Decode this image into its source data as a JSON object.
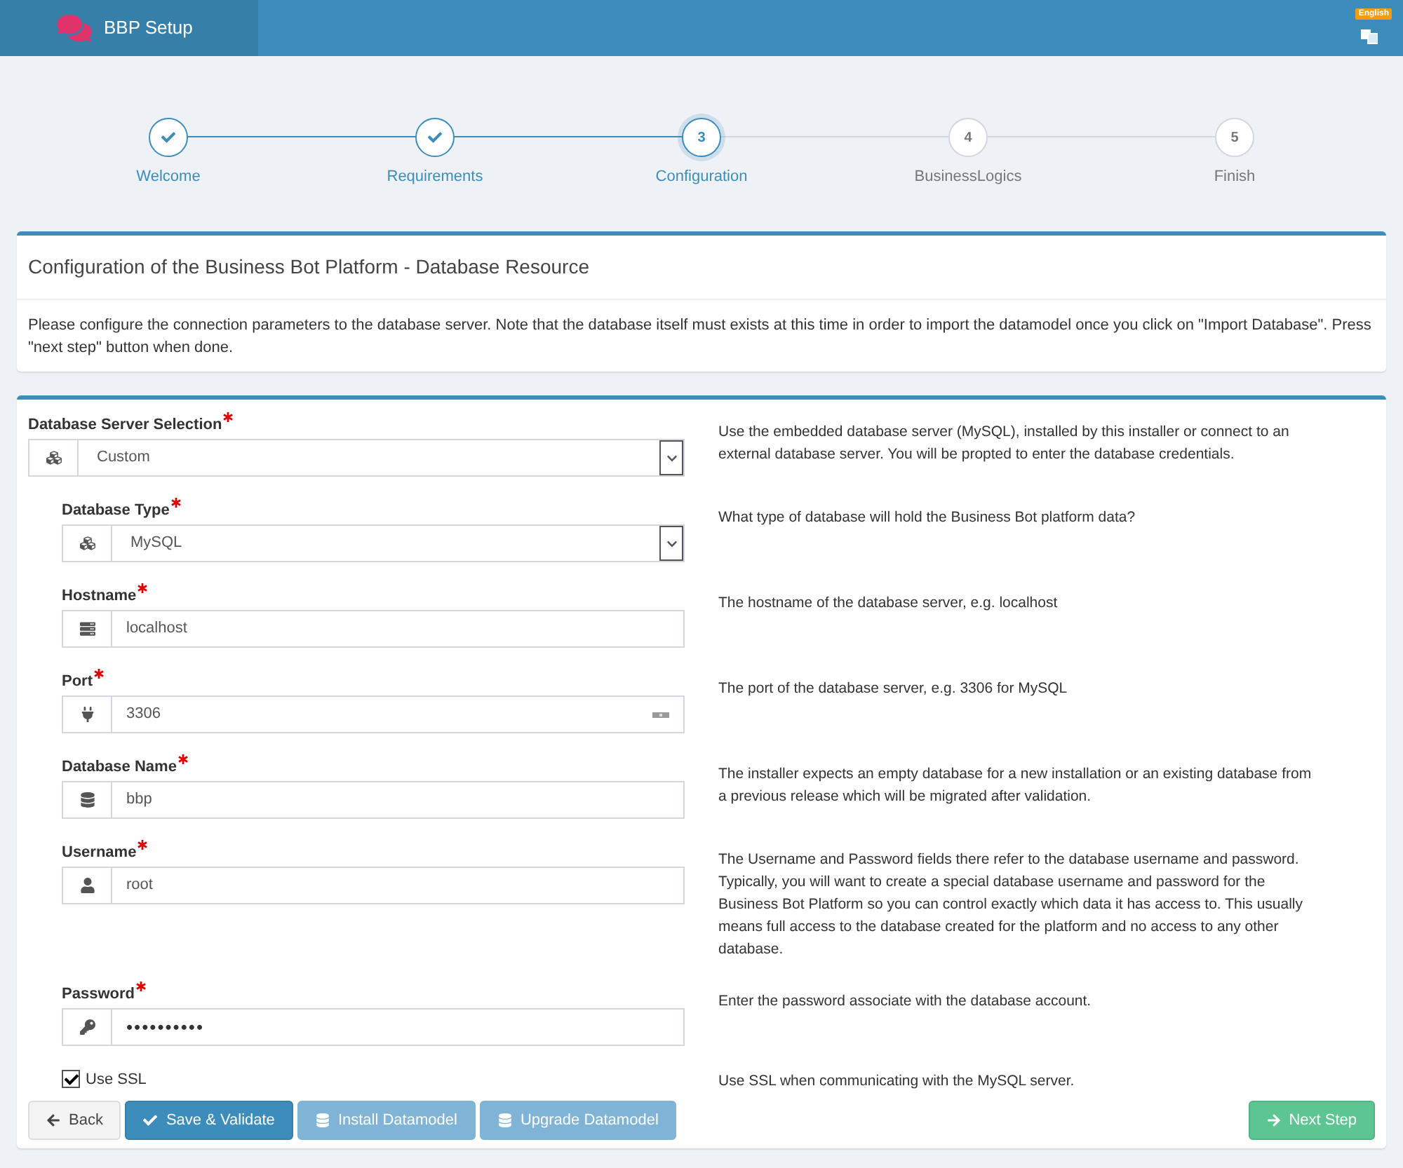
{
  "header": {
    "title": "BBP Setup",
    "language": "English"
  },
  "steps": [
    {
      "label": "Welcome",
      "completed": true,
      "selected": false
    },
    {
      "label": "Requirements",
      "completed": true,
      "selected": false
    },
    {
      "label": "Configuration",
      "completed": false,
      "selected": true,
      "number": "3"
    },
    {
      "label": "BusinessLogics",
      "completed": false,
      "selected": false,
      "number": "4"
    },
    {
      "label": "Finish",
      "completed": false,
      "selected": false,
      "number": "5"
    }
  ],
  "intro": {
    "title": "Configuration of the Business Bot Platform - Database Resource",
    "text": "Please configure the connection parameters to the database server. Note that the database itself must exists at this time in order to import the datamodel once you click on \"Import Database\". Press \"next step\" button when done."
  },
  "fields": [
    {
      "kind": "select",
      "label": "Database Server Selection",
      "required": true,
      "value": "Custom",
      "description": "Use the embedded database server (MySQL), installed by this installer or connect to an external database server. You will be propted to enter the database credentials.",
      "children": [
        {
          "kind": "select",
          "label": "Database Type",
          "required": true,
          "value": "MySQL",
          "description": "What type of database will hold the Business Bot platform data?"
        },
        {
          "kind": "input",
          "label": "Hostname",
          "required": true,
          "value": "localhost",
          "description": "The hostname of the database server, e.g. localhost"
        },
        {
          "kind": "number",
          "label": "Port",
          "required": true,
          "value": "3306",
          "description": "The port of the database server, e.g. 3306 for MySQL"
        },
        {
          "kind": "input",
          "label": "Database Name",
          "required": true,
          "value": "bbp",
          "description": "The installer expects an empty database for a new installation or an existing database from a previous release which will be migrated after validation."
        },
        {
          "kind": "input",
          "label": "Username",
          "required": true,
          "value": "root",
          "description": "The Username and Password fields there refer to the database username and password. Typically, you will want to create a special database username and password for the Business Bot Platform so you can control exactly which data it has access to. This usually means full access to the database created for the platform and no access to any other database."
        },
        {
          "kind": "password",
          "label": "Password",
          "required": true,
          "value": "••••••••••",
          "description": "Enter the password associate with the database account."
        },
        {
          "kind": "checkbox",
          "label": "Use SSL",
          "checked": true,
          "description": "Use SSL when communicating with the MySQL server."
        }
      ]
    }
  ],
  "buttons": [
    {
      "kind": "default",
      "label": "Back",
      "disabled": false
    },
    {
      "kind": "primary",
      "label": "Save & Validate",
      "disabled": false
    },
    {
      "kind": "primary",
      "label": "Install Datamodel",
      "disabled": true
    },
    {
      "kind": "primary",
      "label": "Upgrade Datamodel",
      "disabled": true
    },
    {
      "kind": "success",
      "label": "Next Step",
      "disabled": false
    }
  ]
}
